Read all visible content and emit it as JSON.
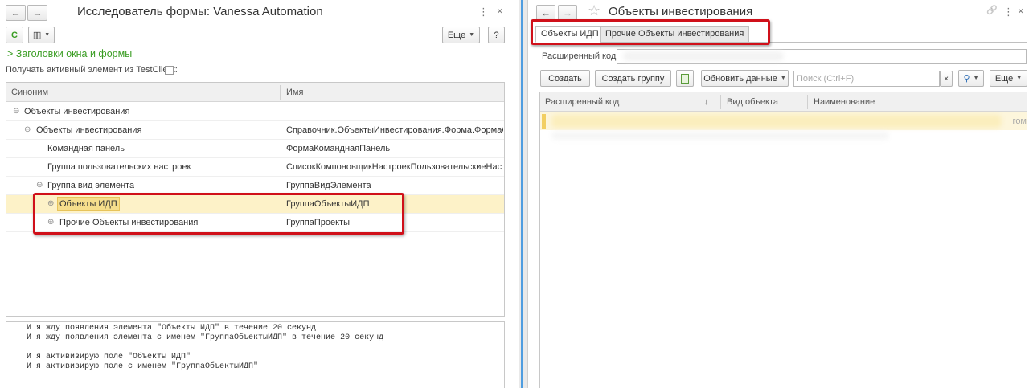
{
  "left": {
    "title": "Исследователь формы: Vanessa Automation",
    "nav": {
      "back": "←",
      "forward": "→"
    },
    "top_icons": {
      "menu": "⋮",
      "close": "×"
    },
    "toolbar": {
      "refresh_icon": "C",
      "view_icon": "▥",
      "more_label": "Еще",
      "help_label": "?"
    },
    "section_link": "Заголовки окна и формы",
    "active_checkbox_label": "Получать активный элемент из TestClient:",
    "table": {
      "columns": [
        "Синоним",
        "Имя"
      ],
      "rows": [
        {
          "synonym": "Объекты инвестирования",
          "name": "",
          "toggle": "⊖"
        },
        {
          "synonym": "Объекты инвестирования",
          "name": "Справочник.ОбъектыИнвестирования.Форма.ФормаС...",
          "toggle": "⊖"
        },
        {
          "synonym": "Командная панель",
          "name": "ФормаКоманднаяПанель",
          "toggle": ""
        },
        {
          "synonym": "Группа пользовательских настроек",
          "name": "СписокКомпоновщикНастроекПользовательскиеНастр...",
          "toggle": ""
        },
        {
          "synonym": "Группа вид элемента",
          "name": "ГруппаВидЭлемента",
          "toggle": "⊖"
        },
        {
          "synonym": "Объекты ИДП",
          "name": "ГруппаОбъектыИДП",
          "toggle": "⊕"
        },
        {
          "synonym": "Прочие Объекты инвестирования",
          "name": "ГруппаПроекты",
          "toggle": "⊕"
        }
      ]
    },
    "log_lines": [
      "И я жду появления элемента \"Объекты ИДП\" в течение 20 секунд",
      "И я жду появления элемента с именем \"ГруппаОбъектыИДП\" в течение 20 секунд",
      "",
      "И я активизирую поле \"Объекты ИДП\"",
      "И я активизирую поле с именем \"ГруппаОбъектыИДП\""
    ]
  },
  "right": {
    "title": "Объекты инвестирования",
    "nav": {
      "back": "←",
      "forward": "→",
      "star": "☆"
    },
    "top_icons": {
      "link": "🔗",
      "menu": "⋮",
      "close": "×"
    },
    "tabs": [
      "Объекты ИДП",
      "Прочие Объекты инвестирования"
    ],
    "ext_code_label": "Расширенный код:",
    "buttons": {
      "create": "Создать",
      "create_group": "Создать группу",
      "refresh": "Обновить данные",
      "more": "Еще"
    },
    "search": {
      "placeholder": "Поиск (Ctrl+F)",
      "clear": "×",
      "find_icon": "🔍"
    },
    "table": {
      "columns": [
        "Расширенный код",
        "Вид объекта",
        "Наименование"
      ],
      "sort_arrow": "↓",
      "visible_tail": "гом"
    }
  },
  "colors": {
    "accent_link": "#3a9d23",
    "selection": "#fdf2c8",
    "highlight_box": "#d0101a",
    "splitter": "#4f9de0"
  }
}
